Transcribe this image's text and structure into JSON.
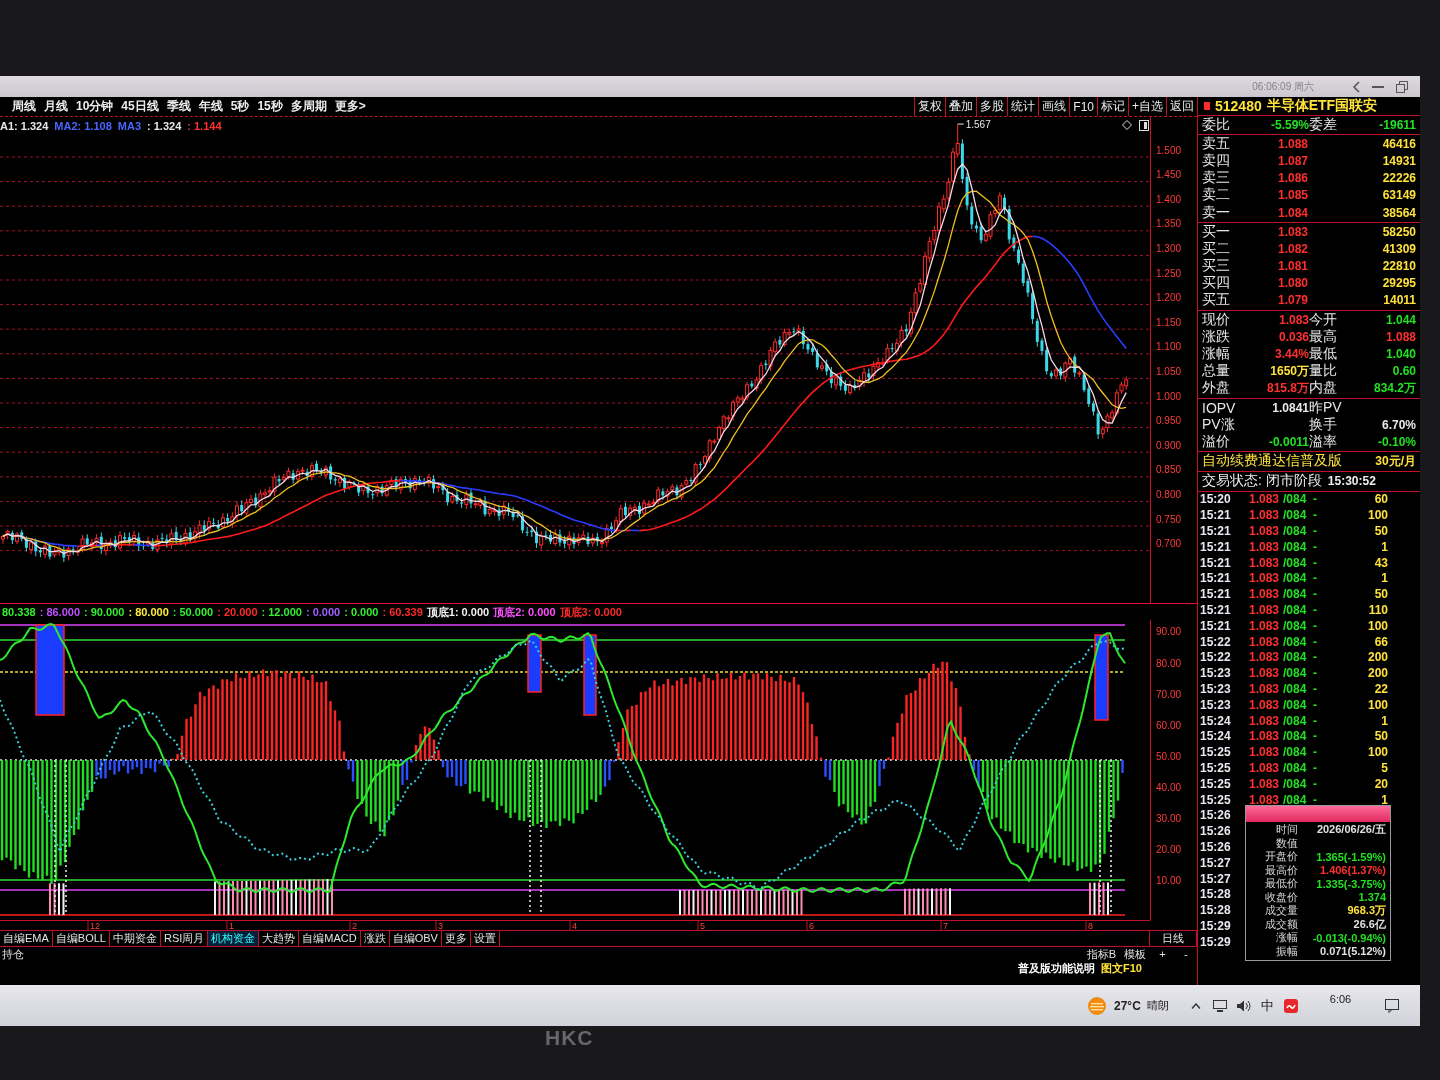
{
  "window": {
    "clock": "06:06:09 周六"
  },
  "toolbar": {
    "periods": [
      "周线",
      "月线",
      "10分钟",
      "45日线",
      "季线",
      "年线",
      "5秒",
      "15秒",
      "多周期",
      "更多>"
    ],
    "tools": [
      "复权",
      "叠加",
      "多股",
      "统计",
      "画线",
      "F10",
      "标记",
      "+自选",
      "返回"
    ]
  },
  "price_chart": {
    "ma_legend": [
      {
        "text": "A1: 1.324",
        "color": "#e8e8e8"
      },
      {
        "text": "MA2: 1.108",
        "color": "#4a66ff"
      },
      {
        "text": "MA3",
        "color": "#4a66ff"
      },
      {
        "text": ": 1.324",
        "color": "#e8e8e8"
      },
      {
        "text": ": 1.144",
        "color": "#ff3030"
      }
    ],
    "peak_label": "1.567",
    "price_ticks": [
      "1.500",
      "1.450",
      "1.400",
      "1.350",
      "1.300",
      "1.250",
      "1.200",
      "1.150",
      "1.100",
      "1.050",
      "1.000",
      "0.950",
      "0.900",
      "0.850",
      "0.800",
      "0.750",
      "0.700"
    ]
  },
  "indicator": {
    "legend": [
      {
        "text": "80.338",
        "color": "#33ee33"
      },
      {
        "text": ": 86.000",
        "color": "#c050ff"
      },
      {
        "text": ": 90.000",
        "color": "#33ee33"
      },
      {
        "text": ": 80.000",
        "color": "#ffee33"
      },
      {
        "text": ": 50.000",
        "color": "#33ee33"
      },
      {
        "text": ": 20.000",
        "color": "#ff2a2a"
      },
      {
        "text": ": 12.000",
        "color": "#33ee33"
      },
      {
        "text": ": 0.000",
        "color": "#a060ff"
      },
      {
        "text": ": 0.000",
        "color": "#33ee33"
      },
      {
        "text": ": 60.339",
        "color": "#ff2a2a"
      },
      {
        "text": "顶底1: 0.000",
        "color": "#f0f0f0"
      },
      {
        "text": "顶底2: 0.000",
        "color": "#ff50ff"
      },
      {
        "text": "顶底3: 0.000",
        "color": "#ff2a2a"
      }
    ],
    "ticks": [
      "90.00",
      "80.00",
      "70.00",
      "60.00",
      "50.00",
      "40.00",
      "30.00",
      "20.00",
      "10.00"
    ],
    "months": [
      "12",
      "1",
      "2",
      "3",
      "4",
      "5",
      "6",
      "7",
      "8"
    ]
  },
  "indicator_tabs": [
    {
      "label": "自编EMA",
      "selected": false
    },
    {
      "label": "自编BOLL",
      "selected": false
    },
    {
      "label": "中期资金",
      "selected": false
    },
    {
      "label": "RSI周月",
      "selected": false
    },
    {
      "label": "机构资金",
      "selected": true
    },
    {
      "label": "大趋势",
      "selected": false
    },
    {
      "label": "自编MACD",
      "selected": false
    },
    {
      "label": "涨跌",
      "selected": false
    },
    {
      "label": "自编OBV",
      "selected": false
    },
    {
      "label": "更多",
      "selected": false
    },
    {
      "label": "设置",
      "selected": false
    }
  ],
  "footer": {
    "period": "日线",
    "position": "持仓",
    "panel_tools": [
      "指标B",
      "模板"
    ],
    "zoom": [
      "+",
      "-"
    ],
    "links": [
      {
        "label": "普及版功能说明",
        "color": "#ffffff"
      },
      {
        "label": "图文F10",
        "color": "#ffe23a"
      }
    ]
  },
  "quote": {
    "code": "512480",
    "name": "半导体ETF国联安",
    "ratio": [
      {
        "label": "委比",
        "value": "-5.59%",
        "color": "#22e022"
      },
      {
        "label": "委差",
        "value": "-19611",
        "color": "#22e022"
      }
    ],
    "asks": [
      {
        "label": "卖五",
        "price": "1.088",
        "volume": "46416"
      },
      {
        "label": "卖四",
        "price": "1.087",
        "volume": "14931"
      },
      {
        "label": "卖三",
        "price": "1.086",
        "volume": "22226"
      },
      {
        "label": "卖二",
        "price": "1.085",
        "volume": "63149"
      },
      {
        "label": "卖一",
        "price": "1.084",
        "volume": "38564"
      }
    ],
    "bids": [
      {
        "label": "买一",
        "price": "1.083",
        "volume": "58250"
      },
      {
        "label": "买二",
        "price": "1.082",
        "volume": "41309"
      },
      {
        "label": "买三",
        "price": "1.081",
        "volume": "22810"
      },
      {
        "label": "买四",
        "price": "1.080",
        "volume": "29295"
      },
      {
        "label": "买五",
        "price": "1.079",
        "volume": "14011"
      }
    ],
    "stats": [
      {
        "label": "现价",
        "value": "1.083",
        "color": "#ff3030"
      },
      {
        "label": "今开",
        "value": "1.044",
        "color": "#22e022"
      },
      {
        "label": "涨跌",
        "value": "0.036",
        "color": "#ff3030"
      },
      {
        "label": "最高",
        "value": "1.088",
        "color": "#ff3030"
      },
      {
        "label": "涨幅",
        "value": "3.44%",
        "color": "#ff3030"
      },
      {
        "label": "最低",
        "value": "1.040",
        "color": "#22e022"
      },
      {
        "label": "总量",
        "value": "1650万",
        "color": "#ffe23a"
      },
      {
        "label": "量比",
        "value": "0.60",
        "color": "#22e022"
      },
      {
        "label": "外盘",
        "value": "815.8万",
        "color": "#ff3030"
      },
      {
        "label": "内盘",
        "value": "834.2万",
        "color": "#22e022"
      }
    ],
    "etf": [
      {
        "label": "IOPV",
        "value": "1.0841",
        "color": "#e8e8e8"
      },
      {
        "label": "昨PV"
      },
      {
        "label": "PV涨"
      },
      {
        "label": "换手",
        "value": "6.70%",
        "color": "#e8e8e8"
      },
      {
        "label": "溢价",
        "value": "-0.0011",
        "color": "#22e022"
      },
      {
        "label": "溢率",
        "value": "-0.10%",
        "color": "#22e022"
      }
    ],
    "ad": {
      "text": "自动续费通达信普及版",
      "price": "30元/月"
    },
    "status": {
      "text": "交易状态: 闭市阶段",
      "time": "15:30:52"
    },
    "ticks": [
      {
        "time": "15:20",
        "price": "1.083",
        "tail": "/084",
        "mark": "-",
        "volume": "60"
      },
      {
        "time": "15:21",
        "price": "1.083",
        "tail": "/084",
        "mark": "-",
        "volume": "100"
      },
      {
        "time": "15:21",
        "price": "1.083",
        "tail": "/084",
        "mark": "-",
        "volume": "50"
      },
      {
        "time": "15:21",
        "price": "1.083",
        "tail": "/084",
        "mark": "-",
        "volume": "1"
      },
      {
        "time": "15:21",
        "price": "1.083",
        "tail": "/084",
        "mark": "-",
        "volume": "43"
      },
      {
        "time": "15:21",
        "price": "1.083",
        "tail": "/084",
        "mark": "-",
        "volume": "1"
      },
      {
        "time": "15:21",
        "price": "1.083",
        "tail": "/084",
        "mark": "-",
        "volume": "50"
      },
      {
        "time": "15:21",
        "price": "1.083",
        "tail": "/084",
        "mark": "-",
        "volume": "110"
      },
      {
        "time": "15:21",
        "price": "1.083",
        "tail": "/084",
        "mark": "-",
        "volume": "100"
      },
      {
        "time": "15:22",
        "price": "1.083",
        "tail": "/084",
        "mark": "-",
        "volume": "66"
      },
      {
        "time": "15:22",
        "price": "1.083",
        "tail": "/084",
        "mark": "-",
        "volume": "200"
      },
      {
        "time": "15:23",
        "price": "1.083",
        "tail": "/084",
        "mark": "-",
        "volume": "200"
      },
      {
        "time": "15:23",
        "price": "1.083",
        "tail": "/084",
        "mark": "-",
        "volume": "22"
      },
      {
        "time": "15:23",
        "price": "1.083",
        "tail": "/084",
        "mark": "-",
        "volume": "100"
      },
      {
        "time": "15:24",
        "price": "1.083",
        "tail": "/084",
        "mark": "-",
        "volume": "1"
      },
      {
        "time": "15:24",
        "price": "1.083",
        "tail": "/084",
        "mark": "-",
        "volume": "50"
      },
      {
        "time": "15:25",
        "price": "1.083",
        "tail": "/084",
        "mark": "-",
        "volume": "100"
      },
      {
        "time": "15:25",
        "price": "1.083",
        "tail": "/084",
        "mark": "-",
        "volume": "5"
      },
      {
        "time": "15:25",
        "price": "1.083",
        "tail": "/084",
        "mark": "-",
        "volume": "20"
      },
      {
        "time": "15:25",
        "price": "1.083",
        "tail": "/084",
        "mark": "-",
        "volume": "1"
      },
      {
        "time": "15:26"
      },
      {
        "time": "15:26"
      },
      {
        "time": "15:26"
      },
      {
        "time": "15:27"
      },
      {
        "time": "15:27"
      },
      {
        "time": "15:28"
      },
      {
        "time": "15:28"
      },
      {
        "time": "15:29"
      },
      {
        "time": "15:29"
      }
    ],
    "tooltip": [
      {
        "label": "时间",
        "value": "2026/06/26/五",
        "color": "#e0e0e0"
      },
      {
        "label": "数值"
      },
      {
        "label": "开盘价",
        "value": "1.365(-1.59%)",
        "color": "#22e022"
      },
      {
        "label": "最高价",
        "value": "1.406(1.37%)",
        "color": "#ff3030"
      },
      {
        "label": "最低价",
        "value": "1.335(-3.75%)",
        "color": "#22e022"
      },
      {
        "label": "收盘价",
        "value": "1.374",
        "color": "#22e022"
      },
      {
        "label": "成交量",
        "value": "968.3万",
        "color": "#ffe23a"
      },
      {
        "label": "成交额",
        "value": "26.6亿",
        "color": "#e0e0e0"
      },
      {
        "label": "涨幅",
        "value": "-0.013(-0.94%)",
        "color": "#22e022"
      },
      {
        "label": "振幅",
        "value": "0.071(5.12%)",
        "color": "#e0e0e0"
      }
    ]
  },
  "taskbar": {
    "temperature": "27°C",
    "weather": "晴朗",
    "ime": "中",
    "clock": "6:06"
  },
  "monitor": {
    "brand": "HKC"
  }
}
